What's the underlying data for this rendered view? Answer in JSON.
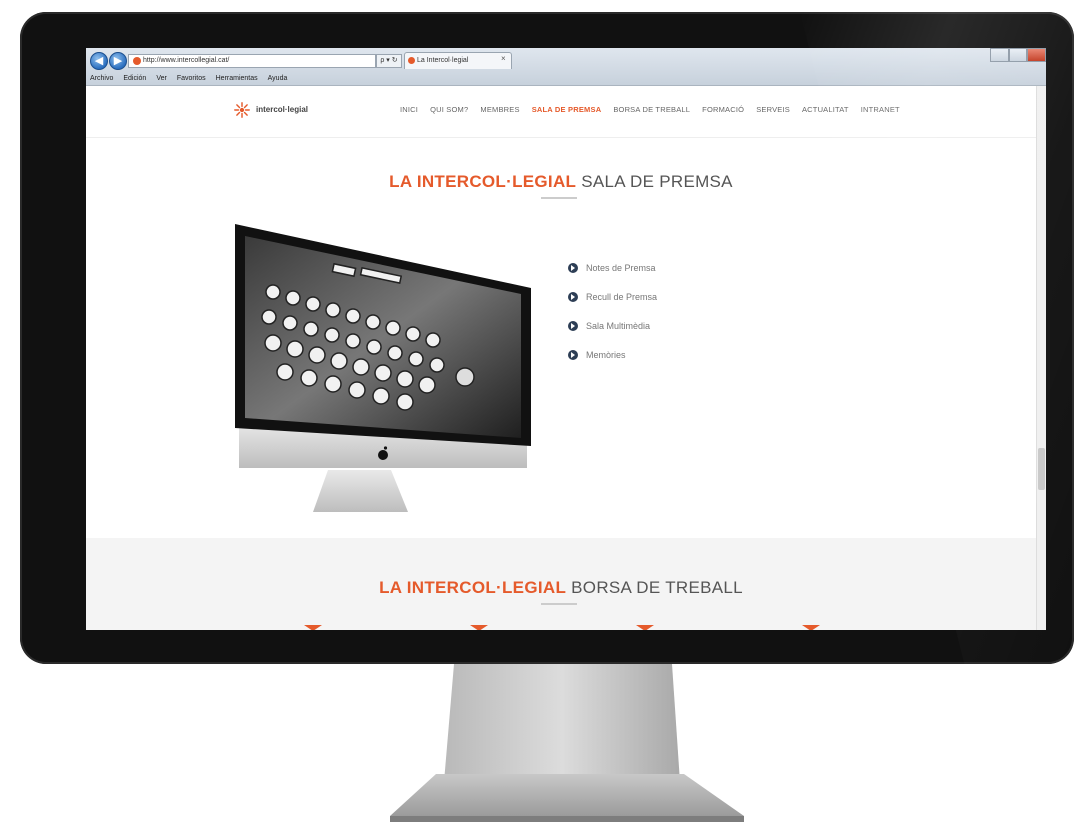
{
  "browser": {
    "address_url": "http://www.intercollegial.cat/",
    "address_tools": "ρ ▾ ↻",
    "tab_title": "La Intercol·legial",
    "tab_close": "×",
    "menu": [
      "Archivo",
      "Edición",
      "Ver",
      "Favoritos",
      "Herramientas",
      "Ayuda"
    ]
  },
  "site": {
    "logo_text": "intercol·legial",
    "nav": [
      "INICI",
      "QUI SOM?",
      "MEMBRES",
      "SALA DE PREMSA",
      "BORSA DE TREBALL",
      "FORMACIÓ",
      "SERVEIS",
      "ACTUALITAT",
      "INTRANET"
    ],
    "active_nav_index": 3
  },
  "section1": {
    "title_accent": "LA INTERCOL·LEGIAL",
    "title_rest": "SALA DE PREMSA",
    "links": [
      "Notes de Premsa",
      "Recull de Premsa",
      "Sala Multimèdia",
      "Memòries"
    ]
  },
  "section2": {
    "title_accent": "LA INTERCOL·LEGIAL",
    "title_rest": "BORSA DE TREBALL"
  },
  "colors": {
    "accent": "#e55a2b",
    "bullet": "#2d3e55",
    "bezel": "#111111"
  }
}
